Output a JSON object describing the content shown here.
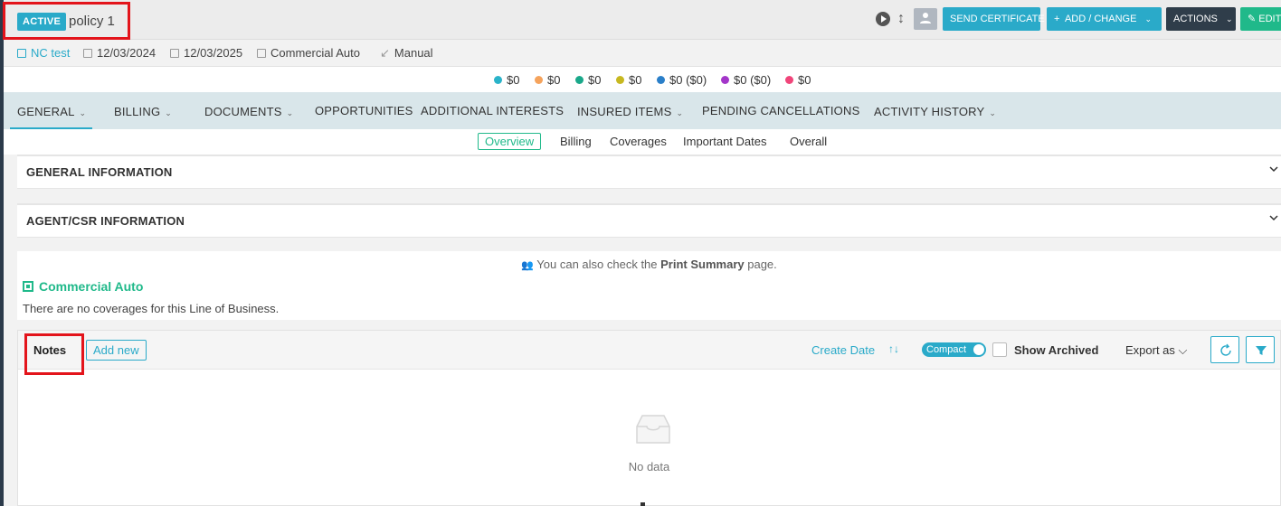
{
  "header": {
    "status_badge": "ACTIVE",
    "policy_name": "policy 1",
    "buttons": {
      "send_certificate": "SEND CERTIFICATE",
      "add_change": "ADD / CHANGE",
      "actions": "ACTIONS",
      "edit": "EDIT"
    }
  },
  "meta": {
    "insured": "NC test",
    "effective_date": "12/03/2024",
    "expiration_date": "12/03/2025",
    "line_of_business": "Commercial Auto",
    "source": "Manual"
  },
  "amounts": [
    {
      "label": "$0",
      "color": "#2ab3c9"
    },
    {
      "label": "$0",
      "color": "#f5a35c"
    },
    {
      "label": "$0",
      "color": "#1aa88a"
    },
    {
      "label": "$0",
      "color": "#c7b820"
    },
    {
      "label": "$0 ($0)",
      "color": "#2a7fc9"
    },
    {
      "label": "$0 ($0)",
      "color": "#a336c9"
    },
    {
      "label": "$0",
      "color": "#f0457a"
    }
  ],
  "nav": {
    "general": "GENERAL",
    "billing": "BILLING",
    "documents": "DOCUMENTS",
    "opportunities": "OPPORTUNITIES",
    "additional_interests": "ADDITIONAL INTERESTS",
    "insured_items": "INSURED ITEMS",
    "pending_cancellations": "PENDING CANCELLATIONS",
    "activity_history": "ACTIVITY HISTORY"
  },
  "subtabs": {
    "overview": "Overview",
    "billing": "Billing",
    "coverages": "Coverages",
    "important_dates": "Important Dates",
    "overall": "Overall"
  },
  "panels": {
    "general_information": "GENERAL INFORMATION",
    "agent_csr_information": "AGENT/CSR INFORMATION"
  },
  "coverage": {
    "print_note_prefix": "You can also check the ",
    "print_note_link": "Print Summary",
    "print_note_suffix": " page.",
    "lob_title": "Commercial Auto",
    "empty_text": "There are no coverages for this Line of Business."
  },
  "notes": {
    "title": "Notes",
    "add_new": "Add new",
    "sort_field": "Create Date",
    "compact_label": "Compact",
    "show_archived": "Show Archived",
    "export_as": "Export as",
    "empty_text": "No data"
  },
  "colors": {
    "accent": "#2aaac9",
    "success": "#20b98a",
    "dark": "#2f3d4a",
    "highlight": "#e3141b"
  }
}
